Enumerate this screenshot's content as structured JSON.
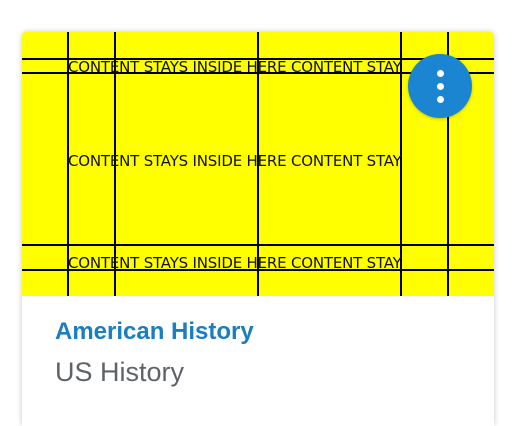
{
  "card": {
    "image": {
      "guide_text": "CONTENT STAYS INSIDE HERE CONTENT STAY",
      "background_color": "#ffff00"
    },
    "menu_button": {
      "icon": "vertical-ellipsis-icon",
      "color": "#1b85d1"
    },
    "title": "American History",
    "subtitle": "US History",
    "title_color": "#1b7ec0"
  }
}
